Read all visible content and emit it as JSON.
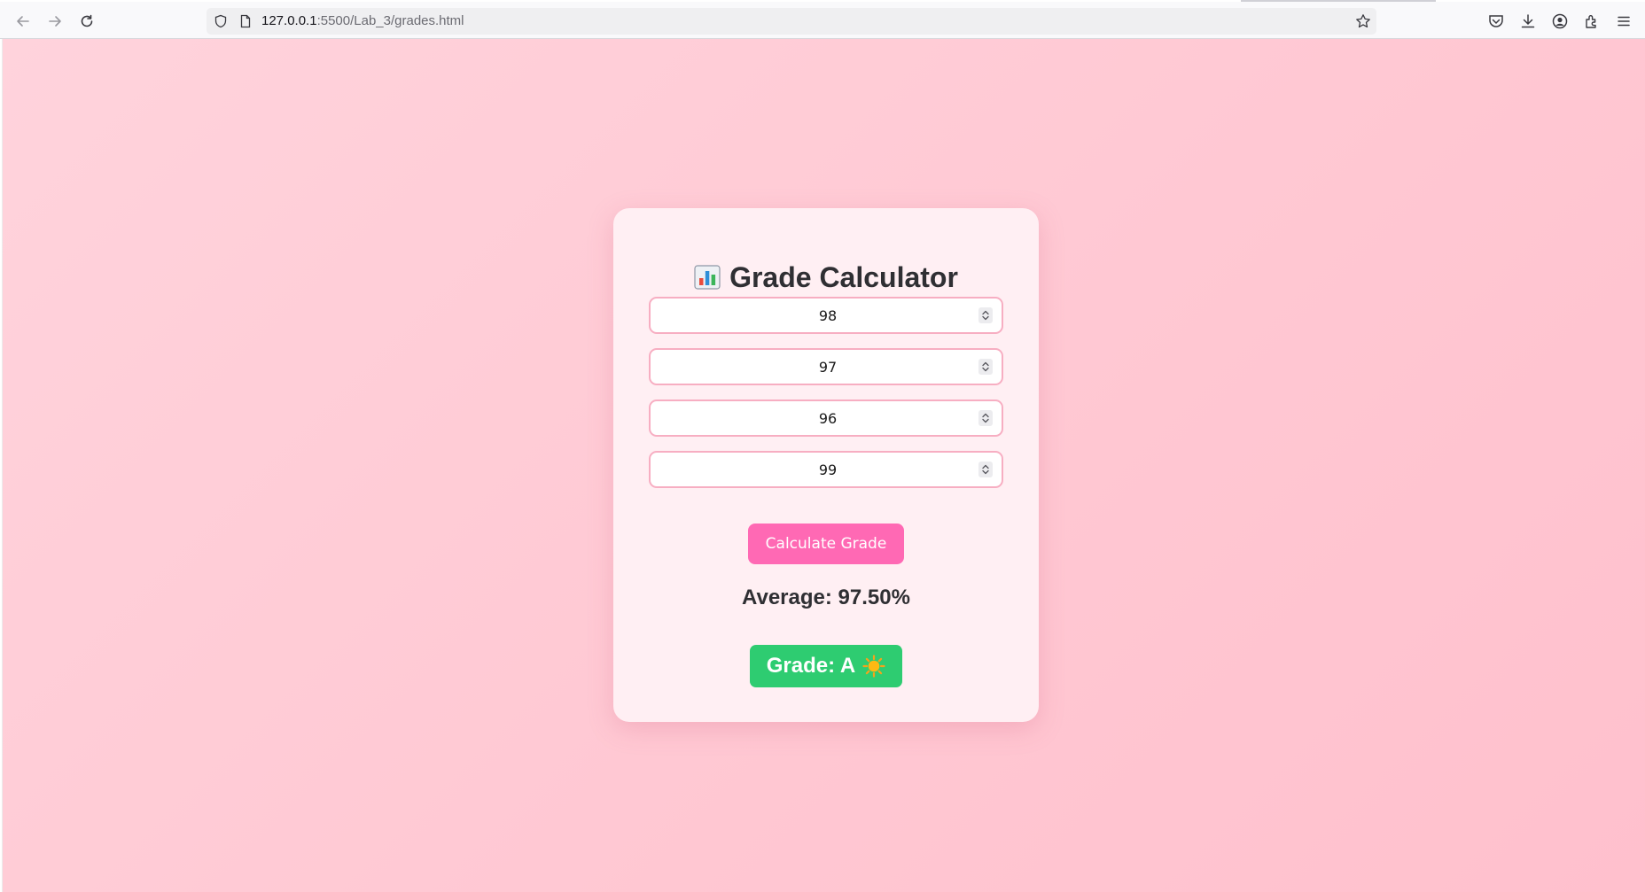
{
  "browser": {
    "url_host": "127.0.0.1",
    "url_path": ":5500/Lab_3/grades.html"
  },
  "card": {
    "title": "Grade Calculator",
    "title_icon": "bar-chart-emoji",
    "inputs": [
      "98",
      "97",
      "96",
      "99"
    ],
    "button_label": "Calculate Grade",
    "average_text": "Average: 97.50%",
    "grade_text": "Grade: A",
    "grade_icon": "sun-emoji"
  },
  "colors": {
    "background": "#ffc8d3",
    "card": "#ffeff3",
    "button": "#ff69b4",
    "grade_badge": "#2ecc71",
    "input_border": "#f7aec2"
  }
}
